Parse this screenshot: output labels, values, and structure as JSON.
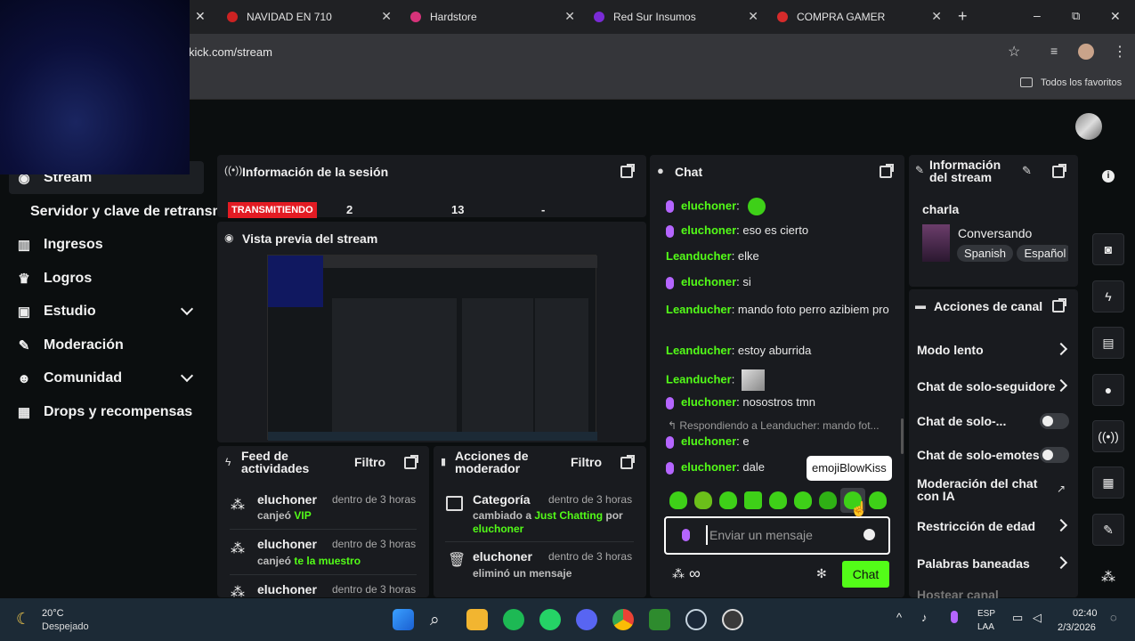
{
  "browser": {
    "tabs": [
      {
        "label": "NAVIDAD EN 710",
        "color": "#cc2222"
      },
      {
        "label": "Hardstore",
        "color": "#d6337a"
      },
      {
        "label": "Red Sur Insumos",
        "color": "#7a2bd6"
      },
      {
        "label": "COMPRA GAMER",
        "color": "#d62b2b"
      }
    ],
    "url": "kick.com/stream",
    "bookmarks_folder": "Todos los favoritos",
    "window_controls": {
      "minimize": "–",
      "maximize": "⧉",
      "close": "✕"
    }
  },
  "sidebar": {
    "items": [
      {
        "label": "Stream",
        "icon": "broadcast-icon"
      },
      {
        "label": "Servidor y clave de retransm",
        "icon": ""
      },
      {
        "label": "Ingresos",
        "icon": "chart-icon"
      },
      {
        "label": "Logros",
        "icon": "trophy-icon"
      },
      {
        "label": "Estudio",
        "icon": "studio-icon"
      },
      {
        "label": "Moderación",
        "icon": "wrench-icon"
      },
      {
        "label": "Comunidad",
        "icon": "people-icon"
      },
      {
        "label": "Drops y recompensas",
        "icon": "gift-icon"
      }
    ]
  },
  "session": {
    "title": "Información de la sesión",
    "status": "TRANSMITIENDO",
    "viewers": "2",
    "followers": "13",
    "other": "-"
  },
  "preview": {
    "title": "Vista previa del stream"
  },
  "activity": {
    "title": "Feed de actividades",
    "filter": "Filtro",
    "items": [
      {
        "name": "eluchoner",
        "time": "dentro de 3 horas",
        "action": "canjeó",
        "reward": "VIP"
      },
      {
        "name": "eluchoner",
        "time": "dentro de 3 horas",
        "action": "canjeó",
        "reward": "te la muestro"
      },
      {
        "name": "eluchoner",
        "time": "dentro de 3 horas",
        "action": "",
        "reward": ""
      }
    ]
  },
  "modactions": {
    "title": "Acciones de moderador",
    "filter": "Filtro",
    "items": [
      {
        "name": "Categoría",
        "time": "dentro de 3 horas",
        "line1": "cambiado a",
        "target": "Just Chatting",
        "by": "por",
        "user": "eluchoner"
      },
      {
        "name": "eluchoner",
        "time": "dentro de 3 horas",
        "line1": "eliminó un mensaje"
      }
    ]
  },
  "chat": {
    "title": "Chat",
    "messages": [
      {
        "user": "eluchoner",
        "text": "",
        "mic": true
      },
      {
        "user": "eluchoner",
        "text": "eso es cierto",
        "mic": true
      },
      {
        "user": "Leanducher",
        "text": "elke",
        "mic": false
      },
      {
        "user": "eluchoner",
        "text": "si",
        "mic": true
      },
      {
        "user": "Leanducher",
        "text": "mando foto perro azibiem pro",
        "mic": false
      },
      {
        "user": "Leanducher",
        "text": "estoy aburrida",
        "mic": false
      },
      {
        "user": "Leanducher",
        "text": "",
        "mic": false
      },
      {
        "user": "eluchoner",
        "text": "nosostros tmn",
        "mic": true
      },
      {
        "user": "eluchoner",
        "text": "e",
        "mic": true
      },
      {
        "user": "eluchoner",
        "text": "dale",
        "mic": true
      }
    ],
    "reply_hint": "Respondiendo a Leanducher: mando fot...",
    "tooltip": "emojiBlowKiss",
    "input_placeholder": "Enviar un mensaje",
    "send_button": "Chat"
  },
  "streaminfo": {
    "title": "Información del stream",
    "stream_title": "charla",
    "category": "Conversando",
    "tags": [
      "Spanish",
      "Español"
    ]
  },
  "channel": {
    "title": "Acciones de canal",
    "rows": [
      {
        "label": "Modo lento",
        "control": "chevron"
      },
      {
        "label": "Chat de solo-seguidore",
        "control": "chevron"
      },
      {
        "label": "Chat de solo-...",
        "control": "toggle"
      },
      {
        "label": "Chat de solo-emotes",
        "control": "toggle"
      },
      {
        "label": "Moderación del chat con IA",
        "control": "external"
      },
      {
        "label": "Restricción de edad",
        "control": "chevron"
      },
      {
        "label": "Palabras baneadas",
        "control": "chevron"
      },
      {
        "label": "Hostear canal",
        "control": "none"
      }
    ]
  },
  "taskbar": {
    "weather_temp": "20°C",
    "weather_desc": "Despejado",
    "lang1": "ESP",
    "lang2": "LAA",
    "time": "02:40",
    "date": "2/3/2026"
  }
}
